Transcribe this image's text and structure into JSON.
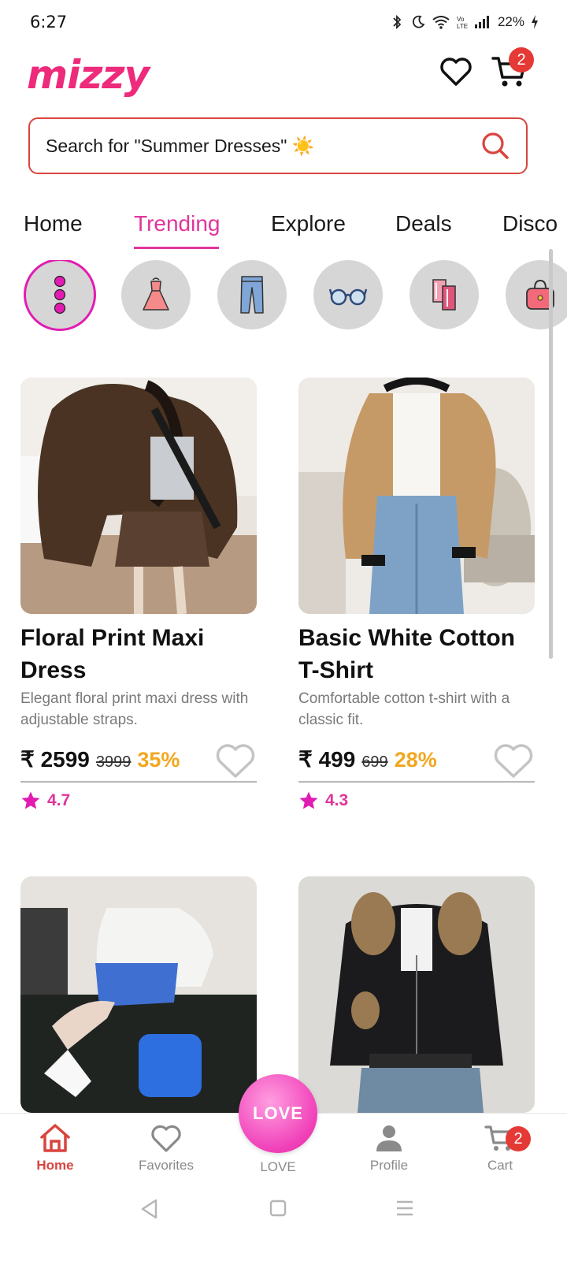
{
  "status": {
    "time": "6:27",
    "battery": "22%"
  },
  "header": {
    "logo": "mizzy",
    "cart_count": "2"
  },
  "search": {
    "placeholder": "Search for \"Summer Dresses\" ☀️"
  },
  "tabs": [
    {
      "label": "Home"
    },
    {
      "label": "Trending",
      "active": true
    },
    {
      "label": "Explore"
    },
    {
      "label": "Deals"
    },
    {
      "label": "Disco"
    }
  ],
  "categories": [
    {
      "icon": "more-dots-icon",
      "active": true
    },
    {
      "icon": "dress-icon"
    },
    {
      "icon": "jeans-icon"
    },
    {
      "icon": "glasses-icon"
    },
    {
      "icon": "scarf-icon"
    },
    {
      "icon": "handbag-icon"
    }
  ],
  "products": [
    {
      "title": "Floral Print Maxi Dress",
      "description": "Elegant floral print maxi dress with adjustable straps.",
      "price": "₹ 2599",
      "mrp": "3999",
      "discount": "35%",
      "rating": "4.7"
    },
    {
      "title": "Basic White Cotton T-Shirt",
      "description": "Comfortable cotton t-shirt with a classic fit.",
      "price": "₹ 499",
      "mrp": "699",
      "discount": "28%",
      "rating": "4.3"
    }
  ],
  "bottom_nav": {
    "home": "Home",
    "favorites": "Favorites",
    "love": "LOVE",
    "love_button": "LOVE",
    "profile": "Profile",
    "cart": "Cart",
    "cart_count": "2"
  },
  "colors": {
    "brand_pink": "#ee2a7b",
    "accent_magenta": "#e0359c",
    "search_border": "#d9453e",
    "discount": "#f2a71f"
  }
}
